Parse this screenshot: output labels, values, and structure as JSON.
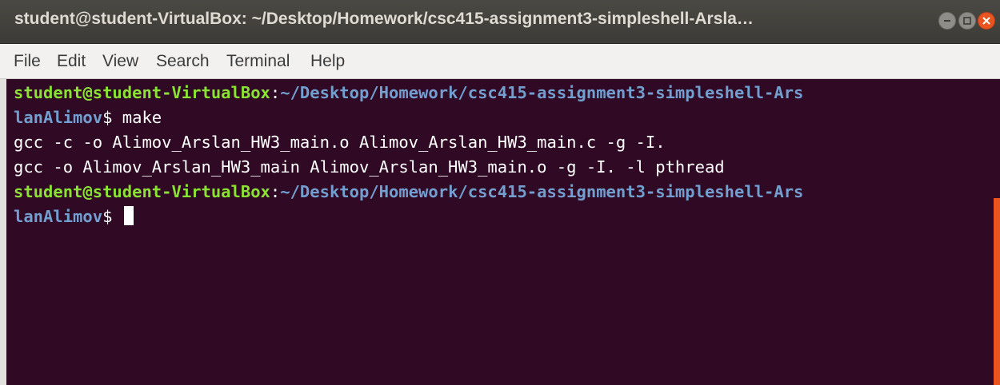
{
  "window": {
    "title": "student@student-VirtualBox: ~/Desktop/Homework/csc415-assignment3-simpleshell-Arsla…"
  },
  "menu": {
    "items": [
      "File",
      "Edit",
      "View",
      "Search",
      "Terminal",
      "Help"
    ]
  },
  "terminal": {
    "lines": [
      {
        "user": "student@student-VirtualBox",
        "sep": ":",
        "path": "~/Desktop/Homework/csc415-assignment3-simpleshell-Ars"
      },
      {
        "path": "lanAlimov",
        "rest": "$ make"
      },
      {
        "rest": "gcc -c -o Alimov_Arslan_HW3_main.o Alimov_Arslan_HW3_main.c -g -I."
      },
      {
        "rest": "gcc -o Alimov_Arslan_HW3_main Alimov_Arslan_HW3_main.o -g -I. -l pthread"
      },
      {
        "user": "student@student-VirtualBox",
        "sep": ":",
        "path": "~/Desktop/Homework/csc415-assignment3-simpleshell-Ars"
      },
      {
        "path": "lanAlimov",
        "rest": "$ "
      }
    ]
  },
  "colors": {
    "background": "#300a24",
    "prompt_user": "#8ae234",
    "prompt_path": "#729fcf",
    "text": "#ffffff",
    "accent": "#e95420"
  },
  "icons": {
    "minimize": "minimize-icon",
    "maximize": "maximize-icon",
    "close": "close-icon"
  }
}
